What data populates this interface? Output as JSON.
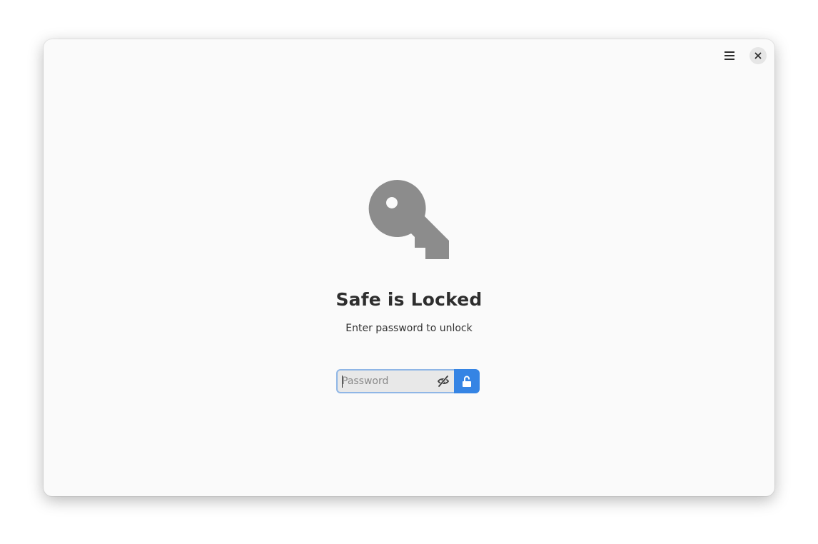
{
  "window": {
    "menu_icon": "hamburger-menu-icon",
    "close_icon": "close-icon"
  },
  "status": {
    "icon": "key-icon",
    "title": "Safe is Locked",
    "description": "Enter password to unlock"
  },
  "unlock": {
    "password_placeholder": "Password",
    "password_value": "",
    "reveal_icon": "eye-hidden-icon",
    "unlock_icon": "unlock-padlock-icon"
  },
  "colors": {
    "accent": "#3584e4",
    "window_bg": "#fafafa",
    "icon_gray": "#8c8c8c",
    "text": "#2e2e2e"
  }
}
